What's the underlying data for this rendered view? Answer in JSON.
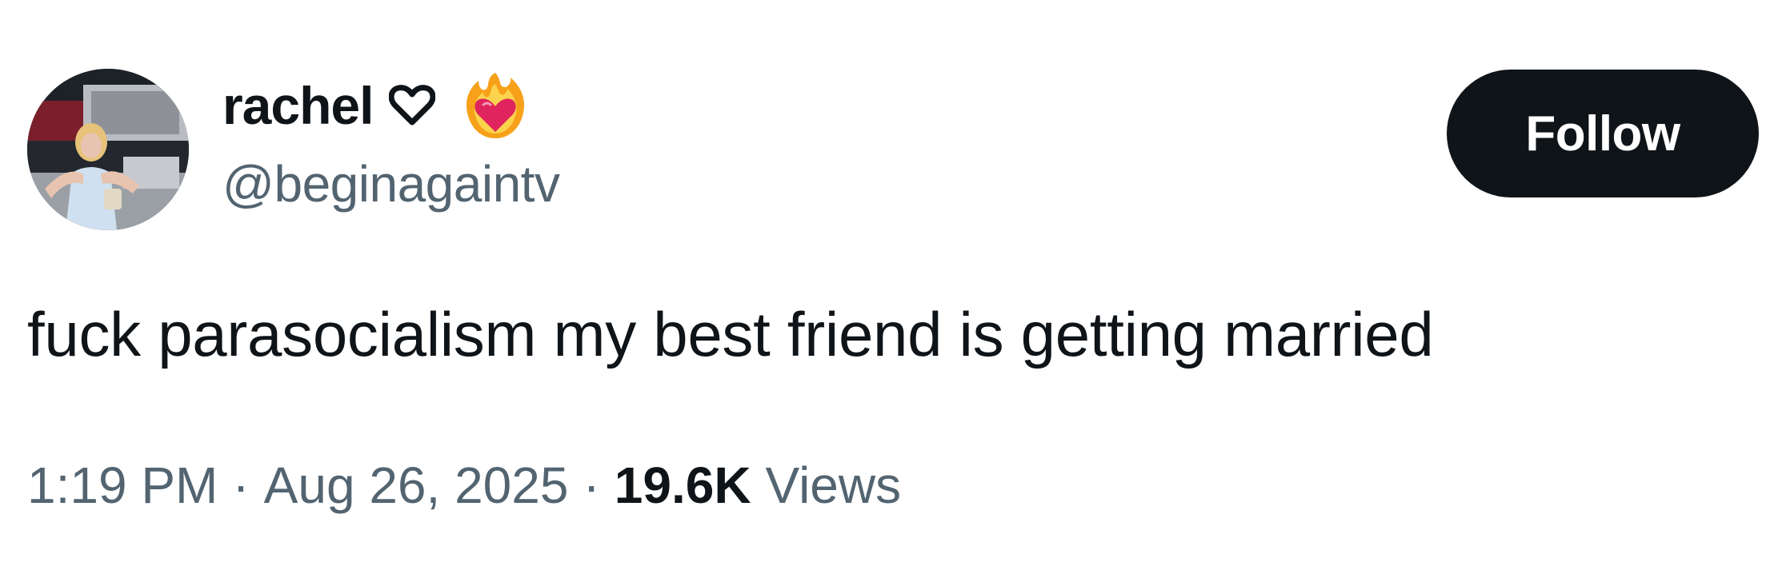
{
  "author": {
    "display_name": "rachel",
    "handle": "@beginagaintv",
    "name_icons": [
      "heart-outline-icon",
      "fire-heart-icon"
    ]
  },
  "follow_button": {
    "label": "Follow"
  },
  "tweet": {
    "text": "fuck parasocialism my best friend is getting married",
    "time": "1:19 PM",
    "date": "Aug 26, 2025",
    "separator": "·",
    "views_count": "19.6K",
    "views_label": "Views"
  },
  "colors": {
    "text_primary": "#0f1419",
    "text_secondary": "#536471",
    "button_bg": "#0f1419",
    "button_text": "#ffffff",
    "background": "#ffffff"
  }
}
